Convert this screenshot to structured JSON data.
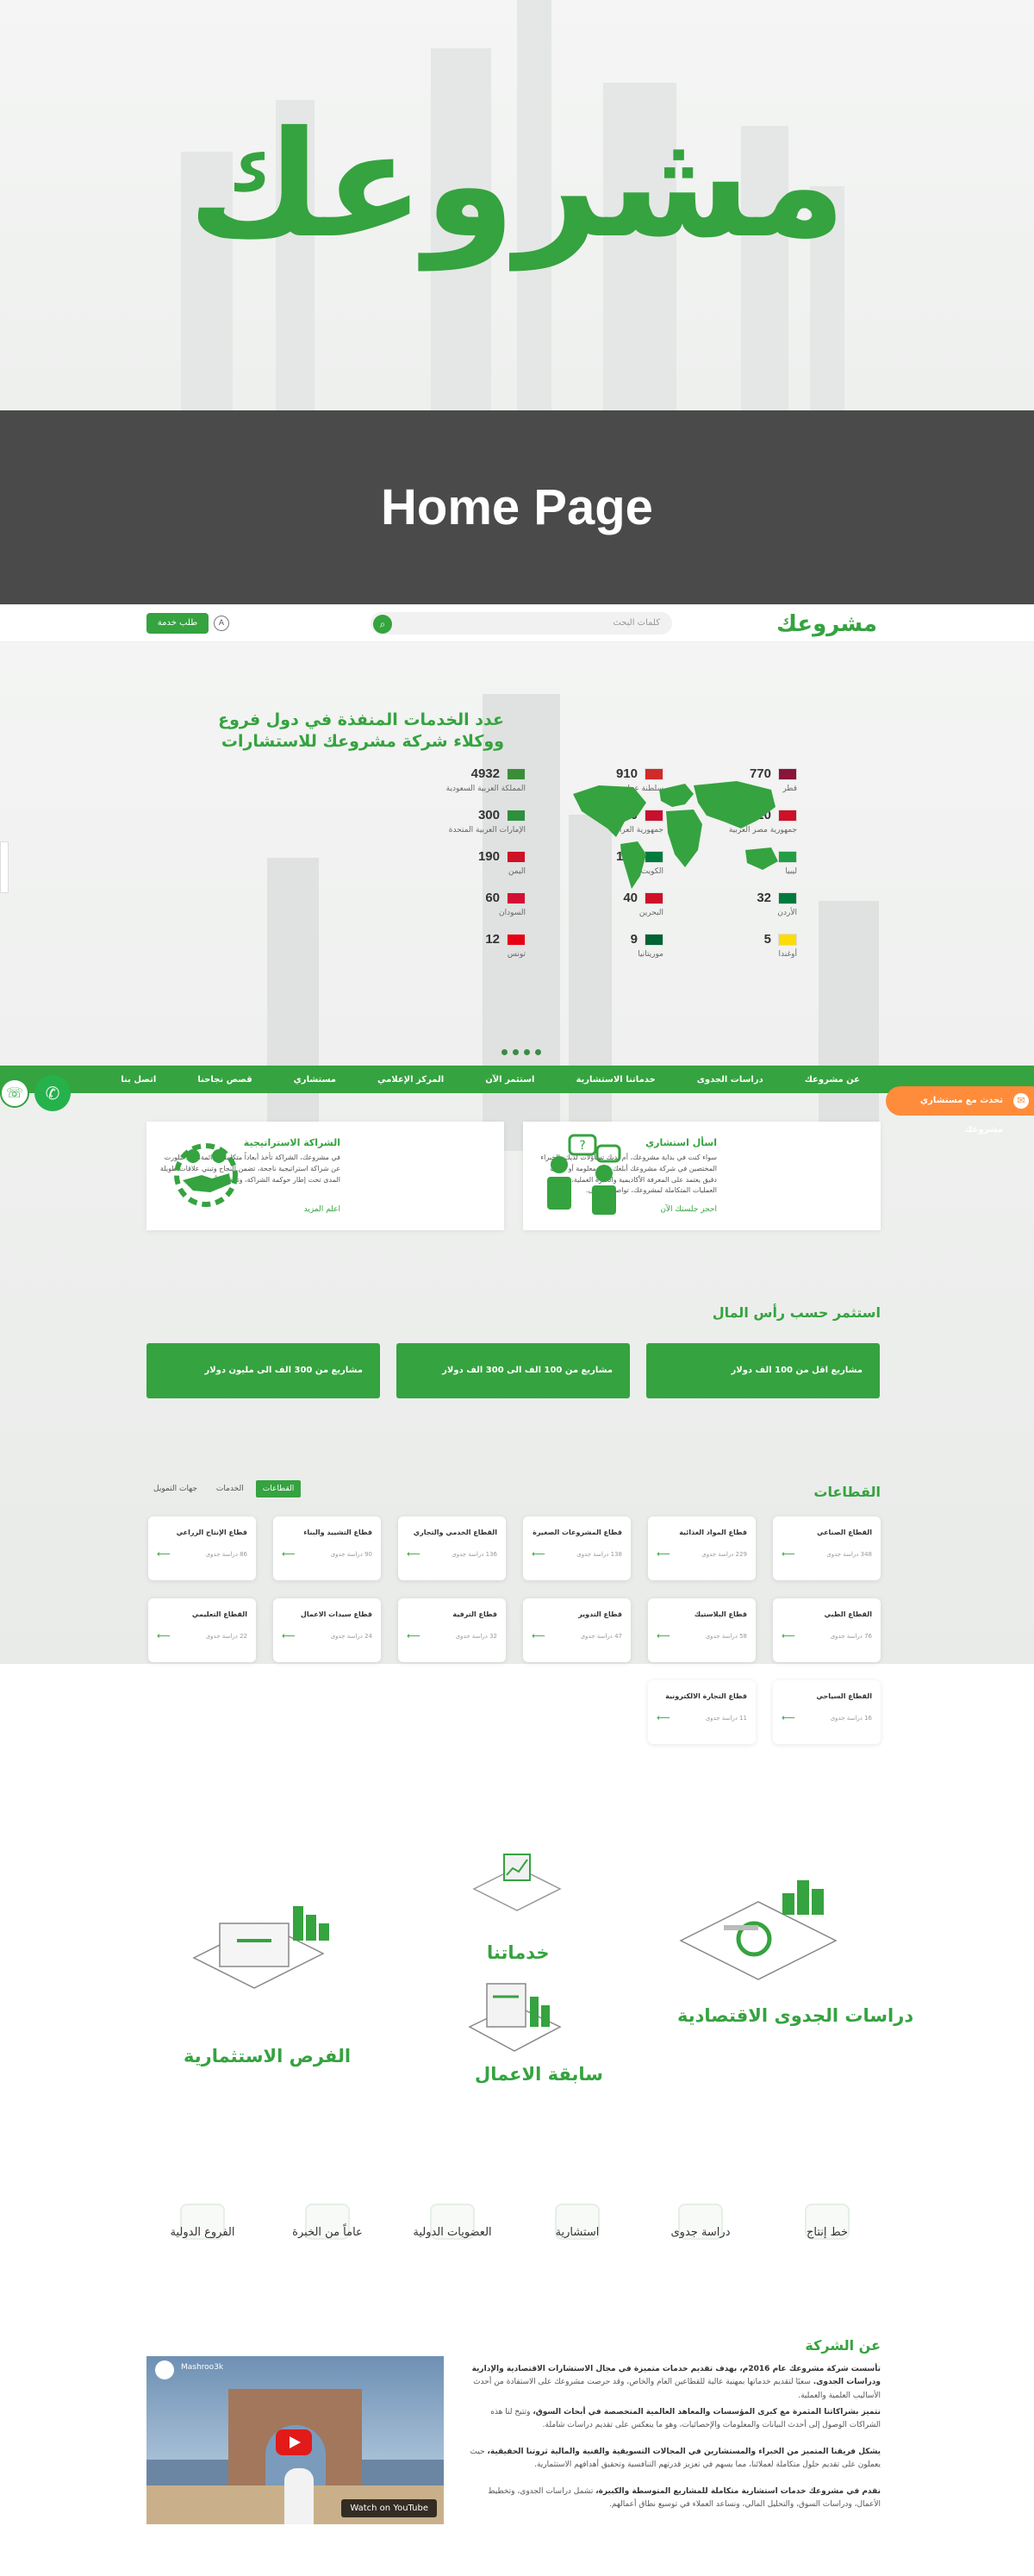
{
  "hero": {
    "logo": "مشروعك"
  },
  "band": {
    "title": "Home Page"
  },
  "topbar": {
    "logo": "مشروعك",
    "search_placeholder": "كلمات البحث",
    "request_button": "طلب خدمة"
  },
  "stats": {
    "title_line1": "عدد الخدمات المنفذة في دول فروع",
    "title_line2": "ووكلاء شركة مشروعك للاستشارات",
    "items": [
      {
        "num": "4932",
        "name": "المملكة العربية السعودية",
        "flag": "#3a8e3a"
      },
      {
        "num": "910",
        "name": "سلطنة عمان",
        "flag": "#d12a2a"
      },
      {
        "num": "770",
        "name": "قطر",
        "flag": "#8a1538"
      },
      {
        "num": "300",
        "name": "الإمارات العربية المتحدة",
        "flag": "#2f8e3f"
      },
      {
        "num": "290",
        "name": "جمهورية العراق",
        "flag": "#c8102e"
      },
      {
        "num": "220",
        "name": "جمهورية مصر العربية",
        "flag": "#ce1126"
      },
      {
        "num": "190",
        "name": "اليمن",
        "flag": "#ce1126"
      },
      {
        "num": "160",
        "name": "الكويت",
        "flag": "#007a3d"
      },
      {
        "num": "70",
        "name": "ليبيا",
        "flag": "#239e46"
      },
      {
        "num": "60",
        "name": "السودان",
        "flag": "#d21034"
      },
      {
        "num": "40",
        "name": "البحرين",
        "flag": "#ce1126"
      },
      {
        "num": "32",
        "name": "الأردن",
        "flag": "#007a3d"
      },
      {
        "num": "12",
        "name": "تونس",
        "flag": "#e70013"
      },
      {
        "num": "9",
        "name": "موريتانيا",
        "flag": "#006233"
      },
      {
        "num": "5",
        "name": "أوغندا",
        "flag": "#fcdc04"
      }
    ]
  },
  "nav": {
    "items": [
      "عن مشروعك",
      "دراسات الجدوى",
      "خدماتنا الاستشارية",
      "استثمر الآن",
      "المركز الإعلامي",
      "مستشاري",
      "قصص نجاحنا",
      "اتصل بنا"
    ],
    "chat": "تحدث مع مستشاري مشروعك",
    "chat_icon": "chat-bubble-icon",
    "whatsapp_icon": "whatsapp-icon",
    "phone_icon": "phone-icon"
  },
  "info_cards": [
    {
      "title": "اسأل استشاري",
      "body": "سواء كنت في بداية مشروعك، أم لديك تساؤلات لديك، الخبراء المختصين في شركة مشروعك أبلغك على معلومة أو جواب دقيق يعتمد على المعرفة الأكاديمية والخبرة العملية، وهيكلة العمليات المتكاملة لمشروعك، تواصل بالأعلى.",
      "link": "احجز جلستك الآن"
    },
    {
      "title": "الشراكة الاستراتيجية",
      "body": "في مشروعك، الشراكة تأخذ أبعاداً متكاملة ودائمة، وقد تبلورت عن شراكة استراتيجية ناجحة، تضمن النجاح وتبني علاقات طويلة المدى تحت إطار حوكمة الشراكة، وتحقق الأهداف.",
      "link": "اعلم المزيد"
    }
  ],
  "invest": {
    "title": "استثمر حسب رأس المال",
    "buttons": [
      "مشاريع اقل من 100 الف دولار",
      "مشاريع من 100 الف الى 300 الف دولار",
      "مشاريع من 300 الف الى مليون دولار"
    ]
  },
  "sectors": {
    "title": "القطاعات",
    "tabs": [
      "القطاعات",
      "الخدمات",
      "جهات التمويل"
    ],
    "items": [
      {
        "name": "القطاع الصناعي",
        "count": "348 دراسة جدوى"
      },
      {
        "name": "قطاع المواد الغذائية",
        "count": "229 دراسة جدوى"
      },
      {
        "name": "قطاع المشروعات الصغيرة",
        "count": "138 دراسة جدوى"
      },
      {
        "name": "القطاع الخدمي والتجاري",
        "count": "136 دراسة جدوى"
      },
      {
        "name": "قطاع التشييد والبناء",
        "count": "90 دراسة جدوى"
      },
      {
        "name": "قطاع الإنتاج الزراعي",
        "count": "86 دراسة جدوى"
      },
      {
        "name": "القطاع الطبي",
        "count": "76 دراسة جدوى"
      },
      {
        "name": "قطاع البلاستيك",
        "count": "58 دراسة جدوى"
      },
      {
        "name": "قطاع التدوير",
        "count": "47 دراسة جدوى"
      },
      {
        "name": "قطاع الترفية",
        "count": "32 دراسة جدوى"
      },
      {
        "name": "قطاع سيدات الاعمال",
        "count": "24 دراسة جدوى"
      },
      {
        "name": "القطاع التعليمي",
        "count": "22 دراسة جدوى"
      },
      {
        "name": "القطاع السياحي",
        "count": "16 دراسة جدوى"
      },
      {
        "name": "قطاع التجارة الالكترونية",
        "count": "11 دراسة جدوى"
      }
    ]
  },
  "services": {
    "items": [
      "خدماتنا",
      "دراسات الجدوى الاقتصادية",
      "الفرص الاستثمارية",
      "سابقة الاعمال"
    ]
  },
  "features": {
    "items": [
      "خط إنتاج",
      "دراسة جدوى",
      "استشارية",
      "العضويات الدولية",
      "عاماً من الخبرة",
      "الفروع الدولية"
    ]
  },
  "about": {
    "title": "عن الشركة",
    "p1_bold": "تأسست شركة مشروعك عام 2016م، بهدف تقديم خدمات متميزة في مجال الاستشارات الاقتصادية والإدارية ودراسات الجدوى.",
    "p1": "سعيًا لتقديم خدماتها بمهنية عالية للقطاعين العام والخاص، وقد حرصت مشروعك على الاستفادة من أحدث الأساليب العلمية والعملية.",
    "p2_bold": "نتميز بشراكاتنا المثمرة مع كبرى المؤسسات والمعاهد العالمية المتخصصة في أبحاث السوق،",
    "p2": "وتتيح لنا هذه الشراكات الوصول إلى أحدث البيانات والمعلومات والإحصائيات، وهو ما ينعكس على تقديم دراسات شاملة.",
    "p3_bold": "يشكل فريقنا المتميز من الخبراء والمستشارين في المجالات التسويقية والفنية والمالية ثروتنا الحقيقية،",
    "p3": "حيث يعملون على تقديم حلول متكاملة لعملائنا، مما يسهم في تعزيز قدرتهم التنافسية وتحقيق أهدافهم الاستثمارية.",
    "p4_bold": "نقدم في مشروعك خدمات استشارية متكاملة للمشاريع المتوسطة والكبيرة،",
    "p4": "تشمل دراسات الجدوى، وتخطيط الأعمال، ودراسات السوق، والتحليل المالي، ونساعد العملاء في توسيع نطاق أعمالهم.",
    "video_channel": "Mashroo3k",
    "video_watch": "Watch on YouTube"
  }
}
